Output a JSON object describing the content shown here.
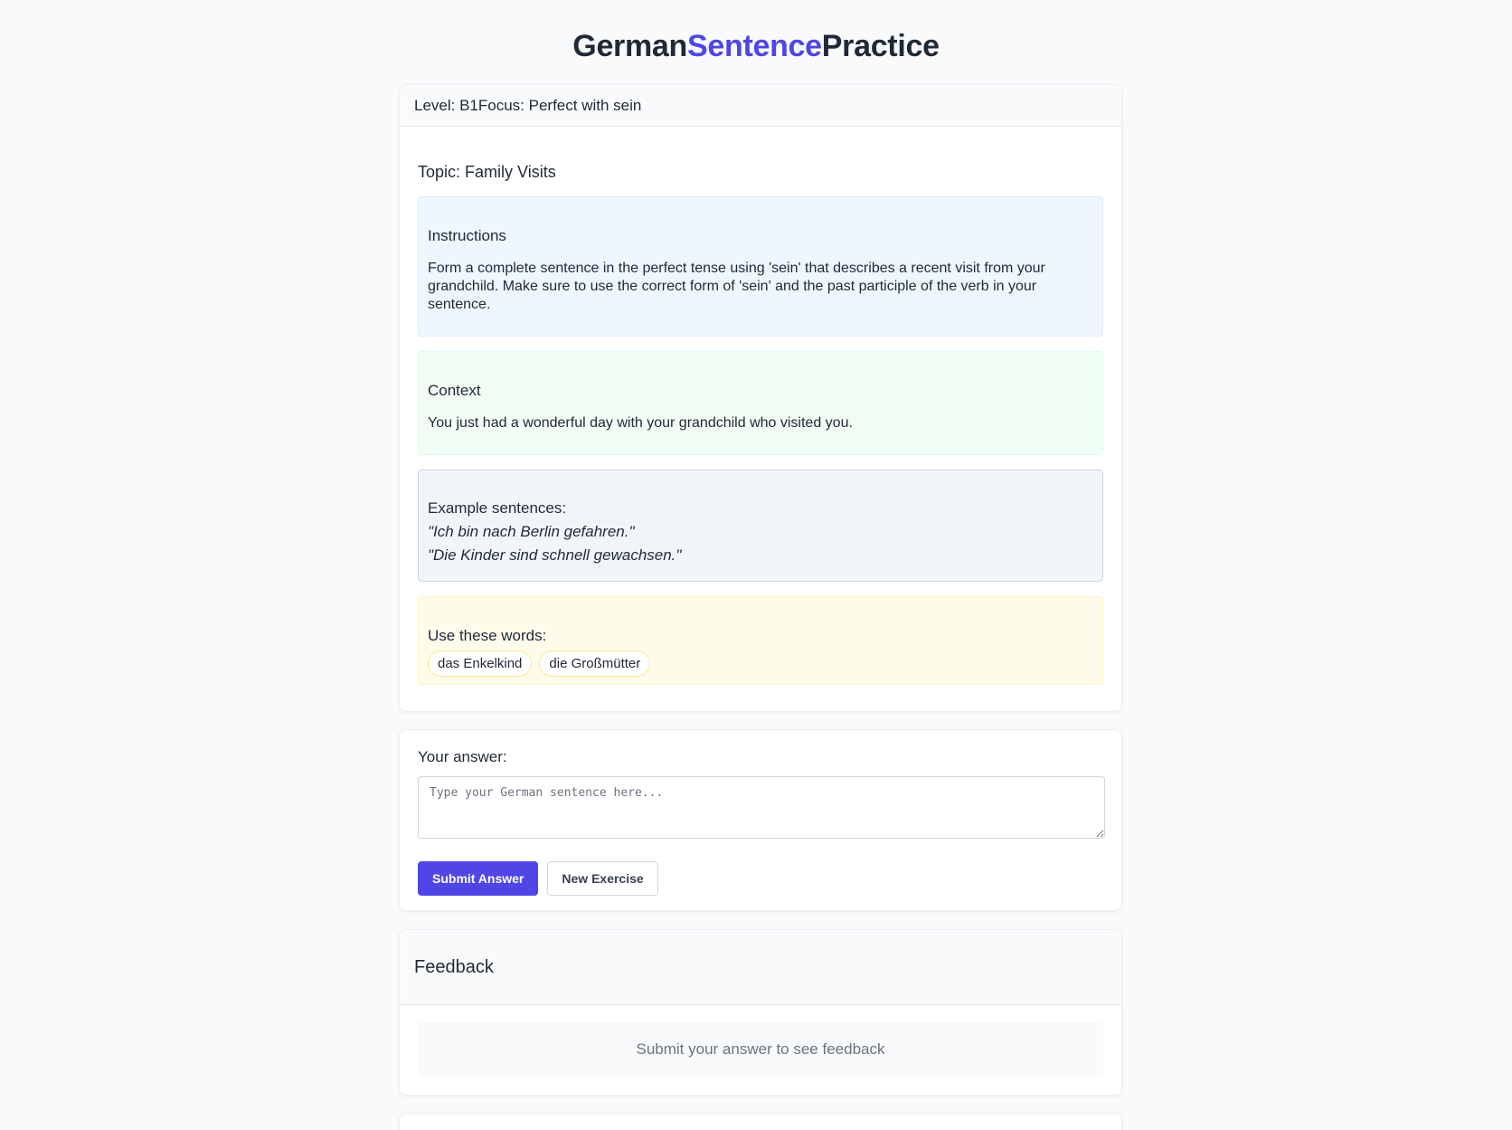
{
  "title": {
    "part1": "German",
    "part2": "Sentence",
    "part3": "Practice",
    "accent_color": "#4f46e5"
  },
  "exercise": {
    "level_label": "Level: B1",
    "focus_label": "Focus: Perfect with sein",
    "topic": "Topic: Family Visits",
    "instructions": {
      "title": "Instructions",
      "text": "Form a complete sentence in the perfect tense using 'sein' that describes a recent visit from your grandchild. Make sure to use the correct form of 'sein' and the past participle of the verb in your sentence."
    },
    "context": {
      "title": "Context",
      "text": "You just had a wonderful day with your grandchild who visited you."
    },
    "examples": {
      "title": "Example sentences:",
      "items": [
        "\"Ich bin nach Berlin gefahren.\"",
        "\"Die Kinder sind schnell gewachsen.\""
      ]
    },
    "words": {
      "title": "Use these words:",
      "items": [
        "das Enkelkind",
        "die Großmütter"
      ]
    }
  },
  "answer": {
    "label": "Your answer:",
    "placeholder": "Type your German sentence here...",
    "value": "",
    "submit_label": "Submit Answer",
    "new_label": "New Exercise"
  },
  "feedback": {
    "title": "Feedback",
    "placeholder": "Submit your answer to see feedback"
  }
}
